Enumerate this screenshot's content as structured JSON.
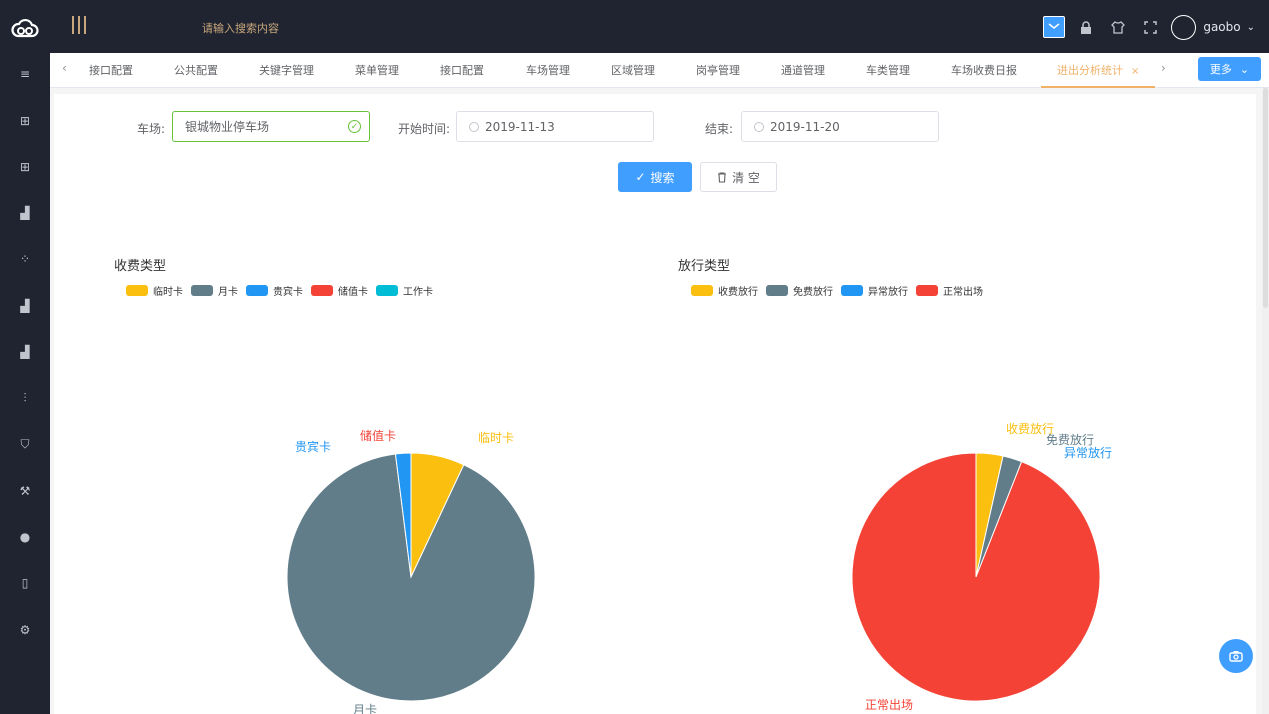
{
  "header": {
    "search_placeholder": "请输入搜索内容",
    "username": "gaobo"
  },
  "sidebar": {
    "icons": [
      "list-icon",
      "grid-icon",
      "grid-icon",
      "bar-chart-icon",
      "apps-icon",
      "bar-chart-icon",
      "bar-chart-icon",
      "sliders-icon",
      "shield-icon",
      "wrench-icon",
      "wechat-icon",
      "phone-icon",
      "gear-icon"
    ]
  },
  "tabs": {
    "items": [
      "接口配置",
      "公共配置",
      "关键字管理",
      "菜单管理",
      "接口配置",
      "车场管理",
      "区域管理",
      "岗亭管理",
      "通道管理",
      "车类管理",
      "车场收费日报"
    ],
    "active": "进出分析统计",
    "more_label": "更多"
  },
  "form": {
    "lot_label": "车场:",
    "lot_value": "银城物业停车场",
    "start_label": "开始时间:",
    "start_value": "2019-11-13",
    "end_label": "结束:",
    "end_value": "2019-11-20",
    "search_btn": "搜索",
    "clear_btn": "清 空"
  },
  "chart_data": [
    {
      "type": "pie",
      "title": "收费类型",
      "legend_position": "top-left",
      "slices": [
        {
          "name": "临时卡",
          "value": 7,
          "color": "#fbbf0f"
        },
        {
          "name": "月卡",
          "value": 91,
          "color": "#617d8a"
        },
        {
          "name": "贵宾卡",
          "value": 2,
          "color": "#2196f3"
        },
        {
          "name": "储值卡",
          "value": 0,
          "color": "#f44336"
        },
        {
          "name": "工作卡",
          "value": 0,
          "color": "#00bcd4"
        }
      ],
      "labels_shown": [
        "临时卡",
        "储值卡",
        "贵宾卡",
        "月卡"
      ]
    },
    {
      "type": "pie",
      "title": "放行类型",
      "legend_position": "top-left",
      "slices": [
        {
          "name": "收费放行",
          "value": 3.5,
          "color": "#fbbf0f"
        },
        {
          "name": "免费放行",
          "value": 2.5,
          "color": "#617d8a"
        },
        {
          "name": "异常放行",
          "value": 0,
          "color": "#2196f3"
        },
        {
          "name": "正常出场",
          "value": 94,
          "color": "#f44336"
        }
      ],
      "labels_shown": [
        "收费放行",
        "免费放行",
        "异常放行",
        "正常出场"
      ]
    }
  ]
}
